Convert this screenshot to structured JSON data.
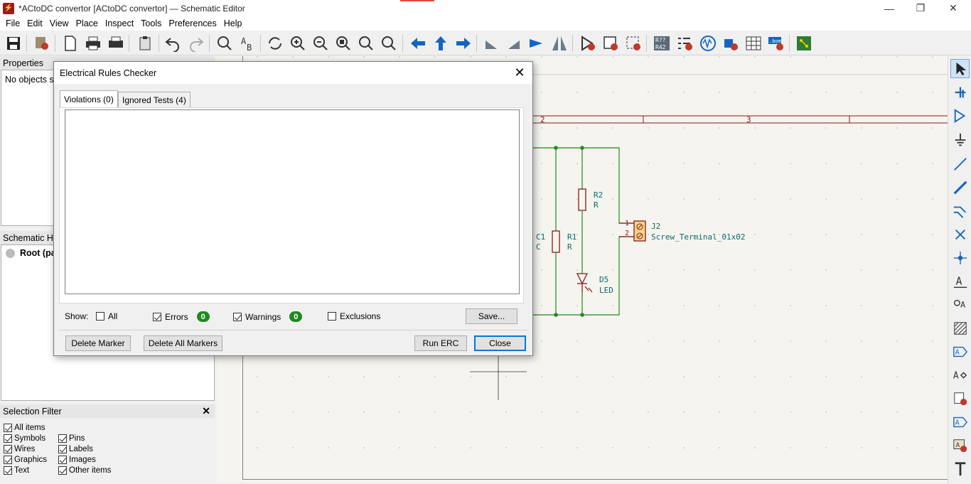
{
  "window": {
    "title": "*ACtoDC convertor [ACtoDC convertor] — Schematic Editor",
    "controls": [
      "—",
      "❐",
      "✕"
    ]
  },
  "menu": [
    "File",
    "Edit",
    "View",
    "Place",
    "Inspect",
    "Tools",
    "Preferences",
    "Help"
  ],
  "left_panels": {
    "properties": {
      "title": "Properties",
      "text": "No objects se"
    },
    "hierarchy": {
      "title": "Schematic Hi",
      "root_label": "Root (pa"
    },
    "selection_filter": {
      "title": "Selection Filter",
      "close": "✕",
      "items": [
        {
          "label": "All items",
          "checked": true
        },
        {
          "label": "Symbols",
          "checked": true
        },
        {
          "label": "Pins",
          "checked": true
        },
        {
          "label": "Wires",
          "checked": true
        },
        {
          "label": "Labels",
          "checked": true
        },
        {
          "label": "Graphics",
          "checked": true
        },
        {
          "label": "Images",
          "checked": true
        },
        {
          "label": "Text",
          "checked": true
        },
        {
          "label": "Other items",
          "checked": true
        }
      ]
    }
  },
  "schematic": {
    "border_labels": [
      "2",
      "3"
    ],
    "components": [
      {
        "ref": "R2",
        "value": "R"
      },
      {
        "ref": "C1",
        "value": "C"
      },
      {
        "ref": "R1",
        "value": "R"
      },
      {
        "ref": "D5",
        "value": "LED"
      },
      {
        "ref": "J2",
        "value": "Screw_Terminal_01x02",
        "pins": [
          "1",
          "2"
        ]
      }
    ]
  },
  "dialog": {
    "title": "Electrical Rules Checker",
    "close": "✕",
    "tabs": [
      "Violations (0)",
      "Ignored Tests (4)"
    ],
    "show_label": "Show:",
    "filters": [
      {
        "label": "All",
        "checked": false
      },
      {
        "label": "Errors",
        "checked": true,
        "count": "0"
      },
      {
        "label": "Warnings",
        "checked": true,
        "count": "0"
      },
      {
        "label": "Exclusions",
        "checked": false
      }
    ],
    "buttons": {
      "save": "Save...",
      "delete_marker": "Delete Marker",
      "delete_all_markers": "Delete All Markers",
      "run_erc": "Run ERC",
      "close": "Close"
    }
  },
  "colors": {
    "wire": "#1f8a1f",
    "symbol": "#8b1a1a",
    "ref_text": "#0a6b6b",
    "badge": "#1e8a1e",
    "canvas": "#f5f4ef",
    "default_button_border": "#0078d7"
  }
}
